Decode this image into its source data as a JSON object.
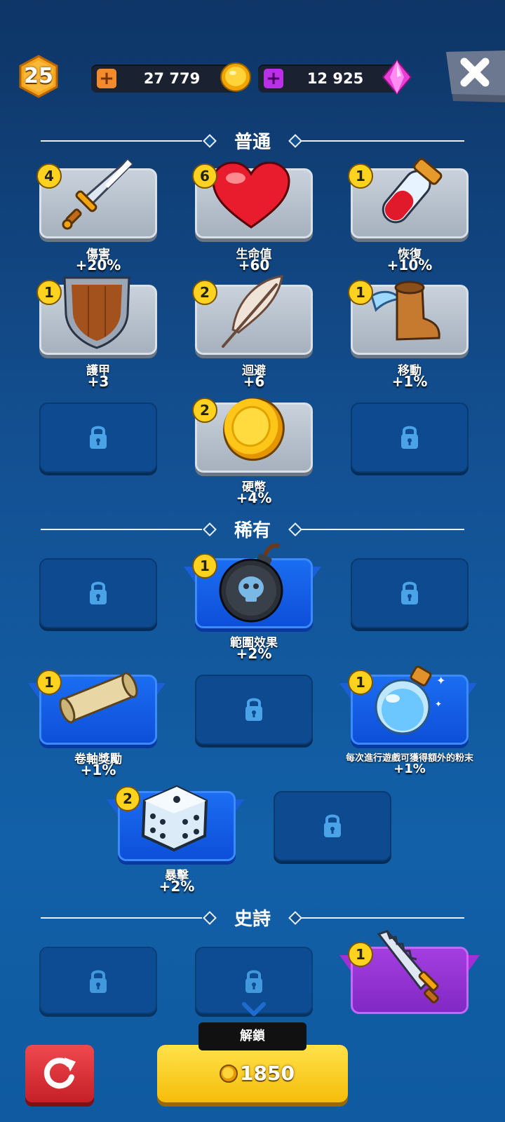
{
  "top_bar": {
    "level": "25",
    "coins": "27 779",
    "gems": "12 925"
  },
  "sections": {
    "common": "普通",
    "rare": "稀有",
    "epic": "史詩"
  },
  "common_items": [
    {
      "name": "傷害",
      "value": "+20%",
      "count": "4",
      "icon": "sword-icon"
    },
    {
      "name": "生命值",
      "value": "+60",
      "count": "6",
      "icon": "heart-icon"
    },
    {
      "name": "恢復",
      "value": "+10%",
      "count": "1",
      "icon": "potion-icon"
    },
    {
      "name": "護甲",
      "value": "+3",
      "count": "1",
      "icon": "shield-icon"
    },
    {
      "name": "迴避",
      "value": "+6",
      "count": "2",
      "icon": "feather-icon"
    },
    {
      "name": "移動",
      "value": "+1%",
      "count": "1",
      "icon": "winged-boot-icon"
    },
    {
      "name": "硬幣",
      "value": "+4%",
      "count": "2",
      "icon": "coin-icon"
    }
  ],
  "rare_items": [
    {
      "name": "範圍效果",
      "value": "+2%",
      "count": "1",
      "icon": "bomb-icon"
    },
    {
      "name": "卷軸獎勵",
      "value": "+1%",
      "count": "1",
      "icon": "scroll-icon"
    },
    {
      "name": "每次進行遊戲可獲得額外的粉末",
      "value": "+1%",
      "count": "1",
      "icon": "dust-flask-icon"
    },
    {
      "name": "暴擊",
      "value": "+2%",
      "count": "2",
      "icon": "dice-icon"
    }
  ],
  "epic_items": [
    {
      "count": "1",
      "icon": "saw-sword-icon"
    }
  ],
  "bottom": {
    "unlock_label": "解鎖",
    "unlock_cost": "1850"
  },
  "colors": {
    "background": "#135092",
    "common_card": "#b8c2cd",
    "rare_card": "#1560e8",
    "epic_card": "#a030d8",
    "badge": "#ffd21f",
    "refresh": "#e0343a",
    "unlock": "#fcd12a"
  }
}
